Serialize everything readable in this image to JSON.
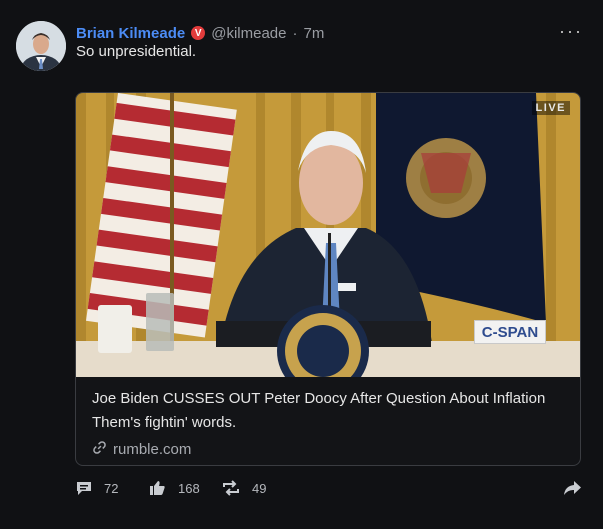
{
  "post": {
    "author_name": "Brian Kilmeade",
    "verified_badge": "V",
    "handle": "@kilmeade",
    "separator": "·",
    "time": "7m",
    "text": "So unpresidential.",
    "more_label": "···"
  },
  "card": {
    "live_label": "LIVE",
    "watermark": "C-SPAN",
    "title": "Joe Biden CUSSES OUT Peter Doocy After Question About Inflation",
    "description": "Them's fightin' words.",
    "domain": "rumble.com"
  },
  "actions": {
    "replies": "72",
    "likes": "168",
    "reposts": "49"
  },
  "colors": {
    "background": "#101114",
    "author": "#4c8cf5",
    "verified": "#e23b3b"
  }
}
